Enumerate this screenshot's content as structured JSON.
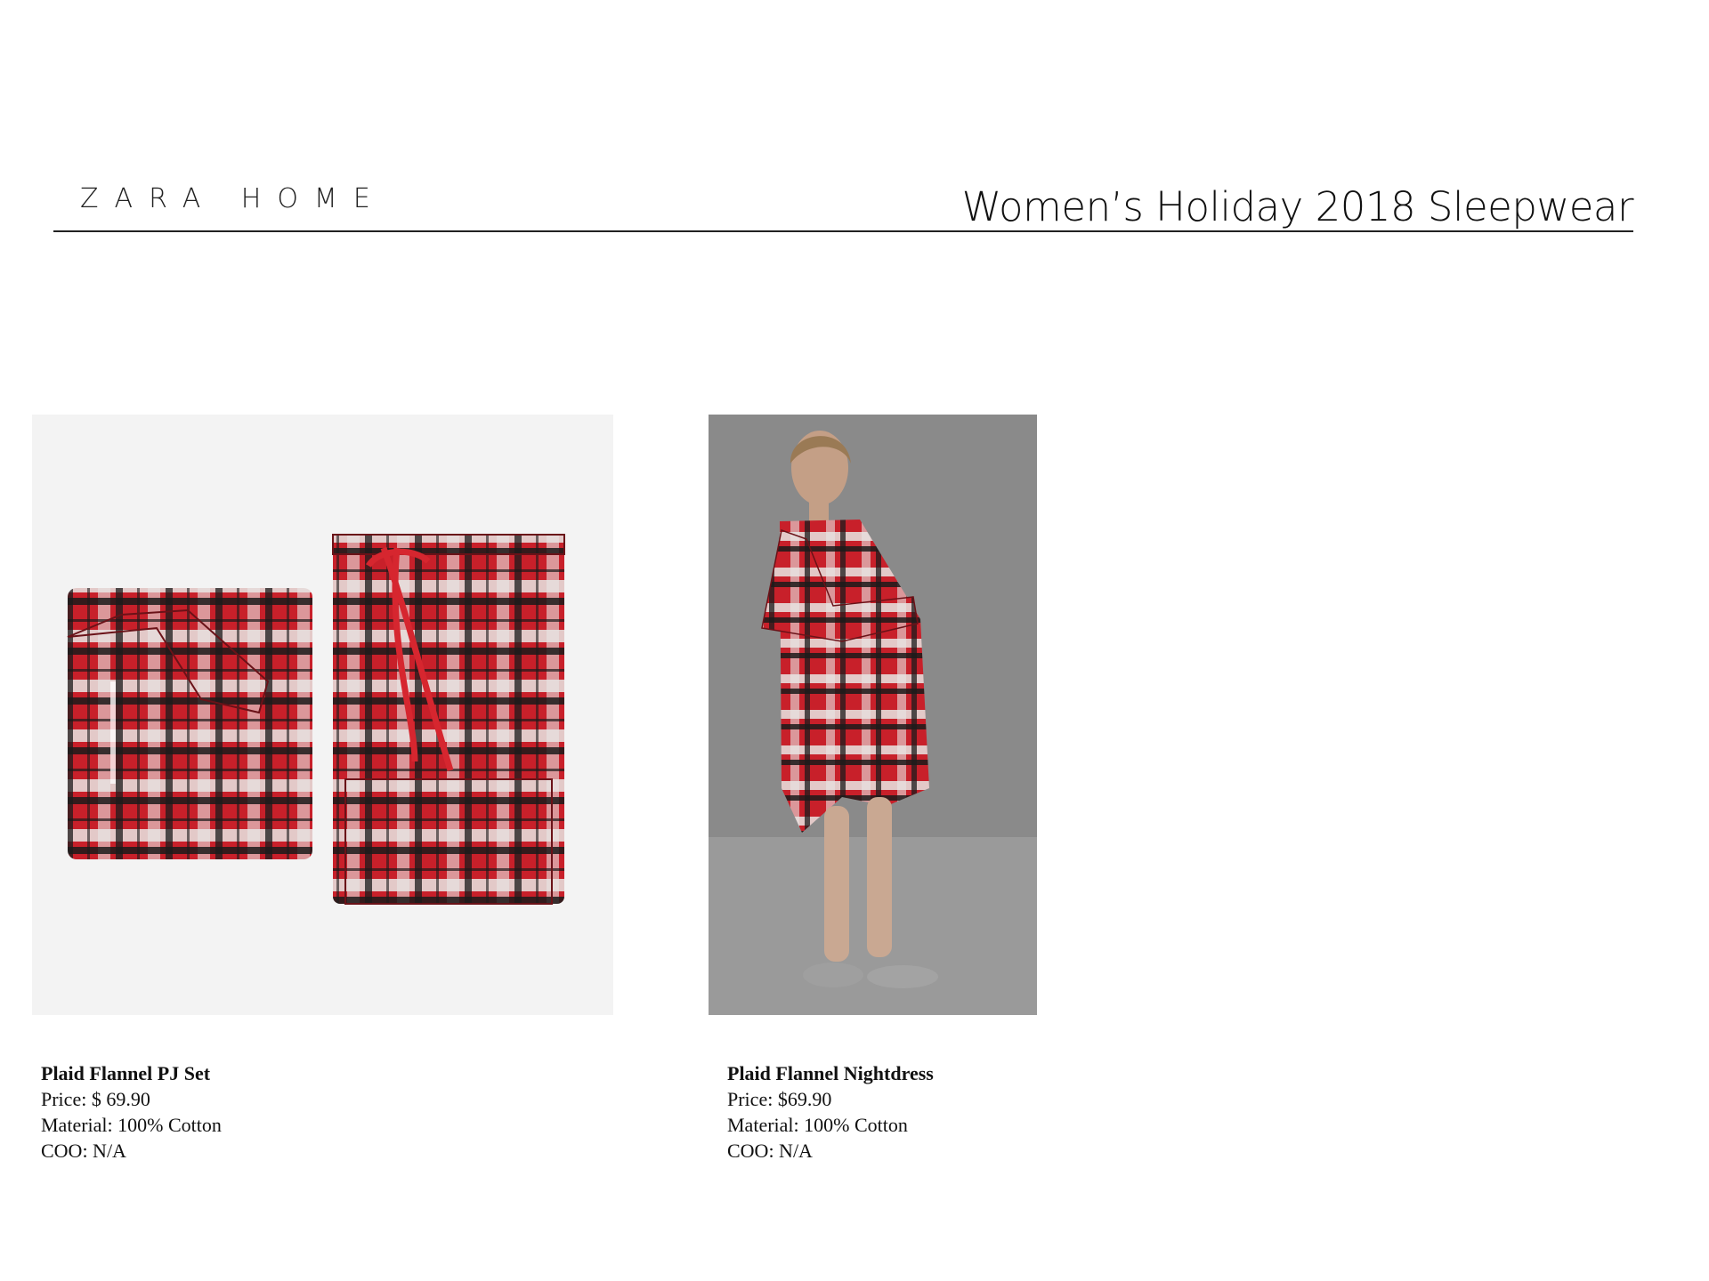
{
  "header": {
    "brand": "ZARA HOME",
    "title": "Women’s Holiday 2018 Sleepwear"
  },
  "products": [
    {
      "name": "Plaid Flannel PJ Set",
      "price": "Price: $ 69.90",
      "material": "Material: 100% Cotton",
      "coo": "COO: N/A"
    },
    {
      "name": "Plaid Flannel Nightdress",
      "price": "Price: $69.90",
      "material": "Material: 100% Cotton",
      "coo": "COO: N/A"
    }
  ],
  "colors": {
    "plaid_red": "#c8202a",
    "plaid_black": "#1a1a1a",
    "plaid_white": "#e8e6e4",
    "studio_gray": "#8c8c8c"
  }
}
